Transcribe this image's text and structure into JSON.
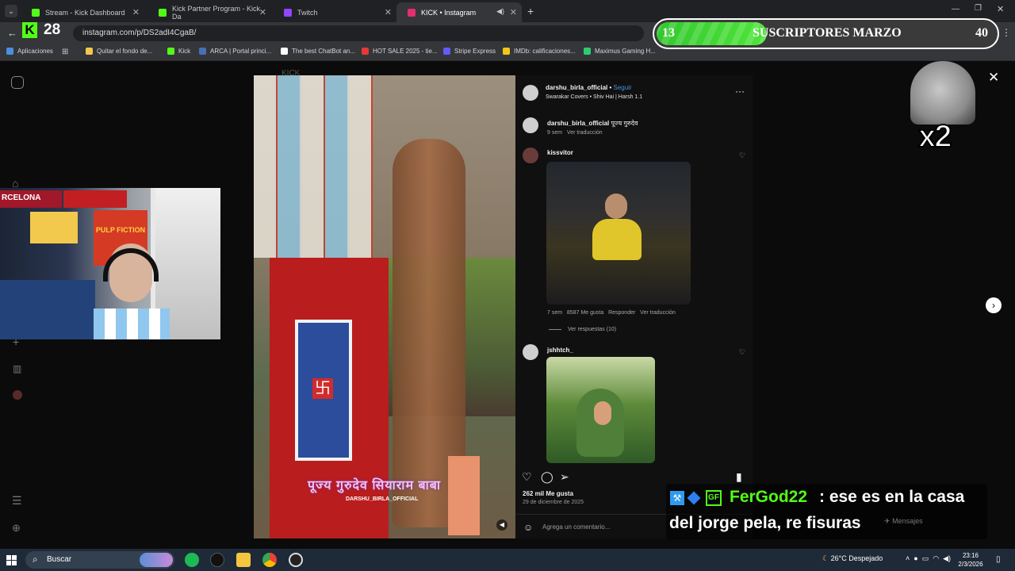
{
  "browser": {
    "tabs": [
      {
        "label": "Stream - Kick Dashboard",
        "color": "#53fc18"
      },
      {
        "label": "Kick Partner Program - Kick Da",
        "color": "#53fc18"
      },
      {
        "label": "Twitch",
        "color": "#9146ff"
      },
      {
        "label": "KICK • Instagram",
        "color": "#e1306c"
      }
    ],
    "url": "instagram.com/p/DS2adI4CgaB/",
    "bookmarks": [
      {
        "label": "Aplicaciones",
        "color": "#4a90e2"
      },
      {
        "label": "Quitar el fondo de...",
        "color": "#f2c94c"
      },
      {
        "label": "Kick",
        "color": "#53fc18"
      },
      {
        "label": "ARCA | Portal princi...",
        "color": "#4a6fb5"
      },
      {
        "label": "The best ChatBot an...",
        "color": "#ffffff"
      },
      {
        "label": "HOT SALE 2025 - tie...",
        "color": "#e53935"
      },
      {
        "label": "Stripe Express",
        "color": "#635bff"
      },
      {
        "label": "IMDb: calificaciones...",
        "color": "#f5c518"
      },
      {
        "label": "Maximus Gaming H...",
        "color": "#2ecc71"
      }
    ]
  },
  "kick_overlay": {
    "logo": "K",
    "count": "28"
  },
  "subs_goal": {
    "current": "13",
    "label": "SUSCRIPTORES MARZO",
    "goal": "40",
    "progress_fraction": 0.325
  },
  "instagram": {
    "ghost_text": "KICK",
    "post": {
      "author": "darshu_birla_official",
      "follow_label": "Seguir",
      "subtitle": "Swarakar Covers • Shiv Hai | Harsh 1.1",
      "caption_author": "darshu_birla_official",
      "caption_text": "पूज्य गुरुदेव",
      "caption_meta": "9 sem",
      "caption_translate": "Ver traducción",
      "video_caption": "पूज्य गुरुदेव सियाराम बाबा",
      "video_watermark": "DARSHU_BIRLA_OFFICIAL",
      "likes": "262 mil Me gusta",
      "date": "29 de diciembre de 2025",
      "comment_placeholder": "Agrega un comentario..."
    },
    "comments": [
      {
        "user": "kissvitor",
        "time": "7 sem",
        "likes": "8587 Me gusta",
        "reply": "Responder",
        "translate": "Ver traducción",
        "view_replies": "Ver respuestas (10)"
      },
      {
        "user": "jshhtch_"
      }
    ]
  },
  "chat": {
    "nick": "FerGod22",
    "message_line1": ": ese es en la casa",
    "message_line2": "del jorge pela, re fisuras",
    "messages_label": "Mensajes"
  },
  "overlay_multiplier": "x2",
  "webcam": {
    "flag_text": "RCELONA",
    "poster_text": "PULP FICTION"
  },
  "taskbar": {
    "search_label": "Buscar",
    "weather": "26°C  Despejado",
    "time": "23:16",
    "date": "2/3/2026"
  }
}
